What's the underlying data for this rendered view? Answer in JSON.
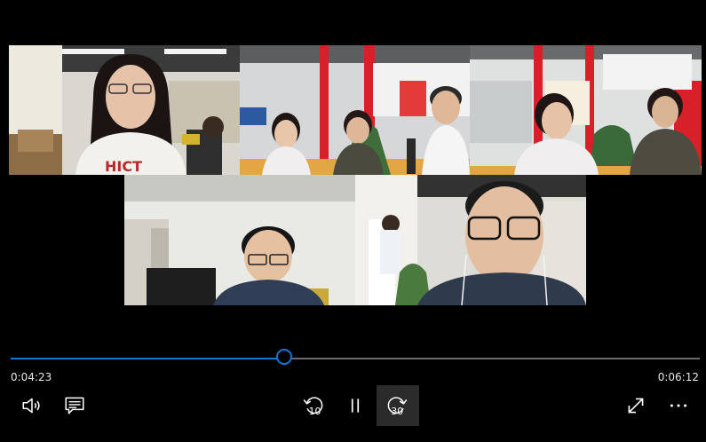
{
  "player": {
    "progress_fraction": 0.4,
    "time_current": "0:04:23",
    "time_total": "0:06:12",
    "skip_back_seconds": "10",
    "skip_forward_seconds": "30",
    "accent_color": "#1a74d3"
  },
  "controls": {
    "volume_icon": "volume-icon",
    "captions_icon": "captions-icon",
    "skip_back_icon": "skip-back-10-icon",
    "pause_icon": "pause-icon",
    "skip_forward_icon": "skip-forward-30-icon",
    "fullscreen_icon": "fullscreen-icon",
    "more_icon": "more-icon"
  },
  "video": {
    "tile_shirt_text": "HICT"
  }
}
